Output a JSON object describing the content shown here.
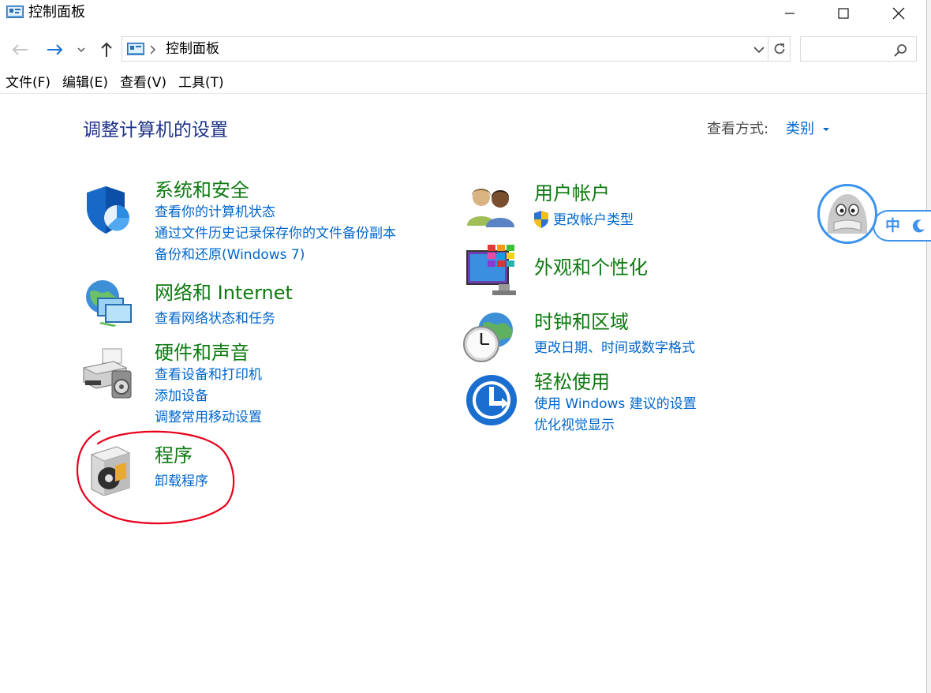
{
  "window": {
    "title": "控制面板",
    "minimize_label": "minimize",
    "maximize_label": "maximize",
    "close_label": "close"
  },
  "nav": {
    "breadcrumb_root": "控制面板",
    "search_placeholder": ""
  },
  "menu": [
    "文件(F)",
    "编辑(E)",
    "查看(V)",
    "工具(T)"
  ],
  "header": {
    "title": "调整计算机的设置",
    "view_by_label": "查看方式:",
    "view_by_value": "类别"
  },
  "categories": {
    "system_security": {
      "title": "系统和安全",
      "links": [
        "查看你的计算机状态",
        "通过文件历史记录保存你的文件备份副本",
        "备份和还原(Windows 7)"
      ]
    },
    "network": {
      "title": "网络和 Internet",
      "links": [
        "查看网络状态和任务"
      ]
    },
    "hardware": {
      "title": "硬件和声音",
      "links": [
        "查看设备和打印机",
        "添加设备",
        "调整常用移动设置"
      ]
    },
    "programs": {
      "title": "程序",
      "links": [
        "卸载程序"
      ]
    },
    "user_accounts": {
      "title": "用户帐户",
      "links": [
        "更改帐户类型"
      ]
    },
    "appearance": {
      "title": "外观和个性化",
      "links": []
    },
    "clock_region": {
      "title": "时钟和区域",
      "links": [
        "更改日期、时间或数字格式"
      ]
    },
    "ease_of_access": {
      "title": "轻松使用",
      "links": [
        "使用 Windows 建议的设置",
        "优化视觉显示"
      ]
    }
  },
  "ime": {
    "mode": "中"
  },
  "colors": {
    "category_title": "#0d7a10",
    "link": "#0066cc",
    "page_title": "#1e3287",
    "annotation": "#e8001c",
    "ime_accent": "#3b93ee"
  }
}
